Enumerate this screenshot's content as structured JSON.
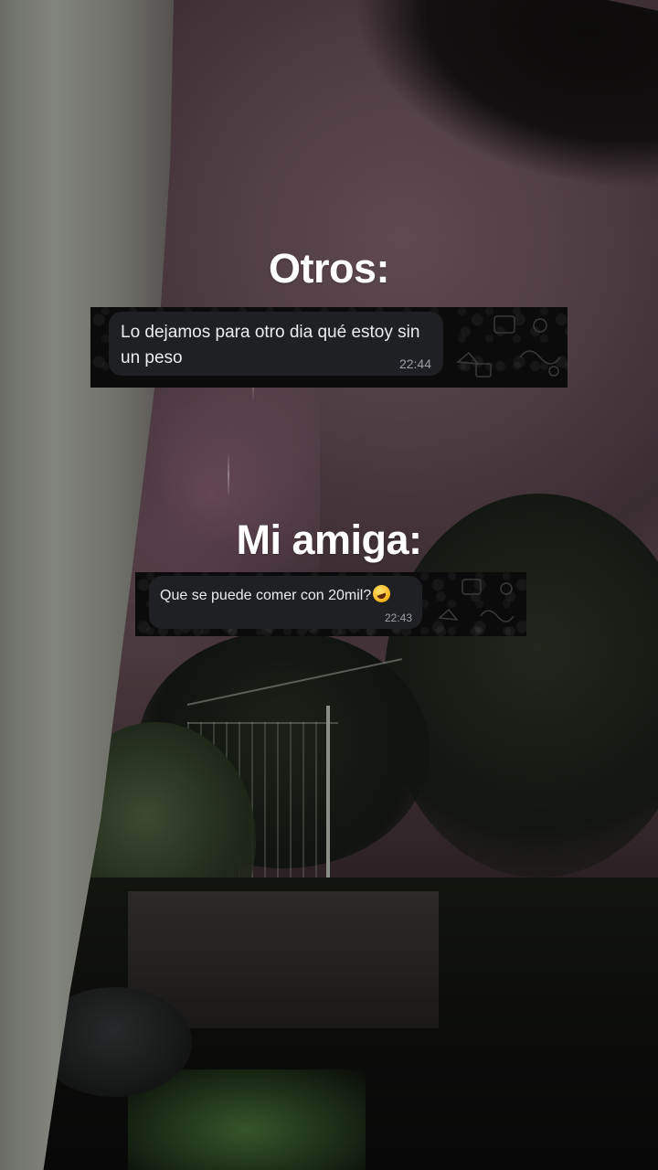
{
  "captions": {
    "first": "Otros:",
    "second": "Mi amiga:"
  },
  "messages": [
    {
      "text": "Lo dejamos para otro dia qué estoy sin un peso",
      "time": "22:44"
    },
    {
      "text": "Que se puede comer con 20mil?",
      "emoji": "rolling-on-floor-laughing",
      "time": "22:43"
    }
  ],
  "colors": {
    "bubble": "#1f2023",
    "bubble_text": "#e9edef",
    "timestamp": "#9aa0a6",
    "caption_text": "#ffffff"
  }
}
